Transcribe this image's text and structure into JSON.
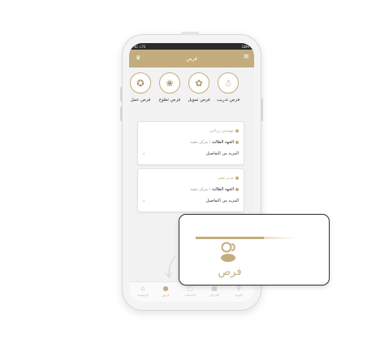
{
  "colors": {
    "accent": "#c3ad7e",
    "card_bg": "#ffffff",
    "screen_bg": "#f2f2f2"
  },
  "status_bar": {
    "left": "4G LTE",
    "right": "100%"
  },
  "app_bar": {
    "title": "فرص",
    "menu_icon": "hamburger-icon",
    "left_icon": "crown-icon"
  },
  "categories": [
    {
      "label": "فرص تدريب",
      "icon": "training-icon"
    },
    {
      "label": "فرص تمويل",
      "icon": "funding-icon"
    },
    {
      "label": "فرص تطوع",
      "icon": "volunteer-icon"
    },
    {
      "label": "فرص عمل",
      "icon": "work-icon"
    }
  ],
  "cards": [
    {
      "title": "مهندس زراعي",
      "entity_label": "الجهة الطالبة :",
      "entity_value": "مركز تنفيذ",
      "more": "المزيد من التفاصيل"
    },
    {
      "title": "مدير تقني",
      "entity_label": "الجهة الطالبة :",
      "entity_value": "مركز تنفيذ",
      "more": "المزيد من التفاصيل"
    }
  ],
  "bottom_nav": [
    {
      "label": "الرئيسية",
      "icon": "home-icon"
    },
    {
      "label": "فرص",
      "icon": "opportunities-icon",
      "active": true
    },
    {
      "label": "الخدمات",
      "icon": "services-icon"
    },
    {
      "label": "المراكز",
      "icon": "centers-icon"
    },
    {
      "label": "المزيد",
      "icon": "location-icon"
    }
  ],
  "zoom_callout": {
    "label": "فرص",
    "icon": "opportunities-icon"
  }
}
